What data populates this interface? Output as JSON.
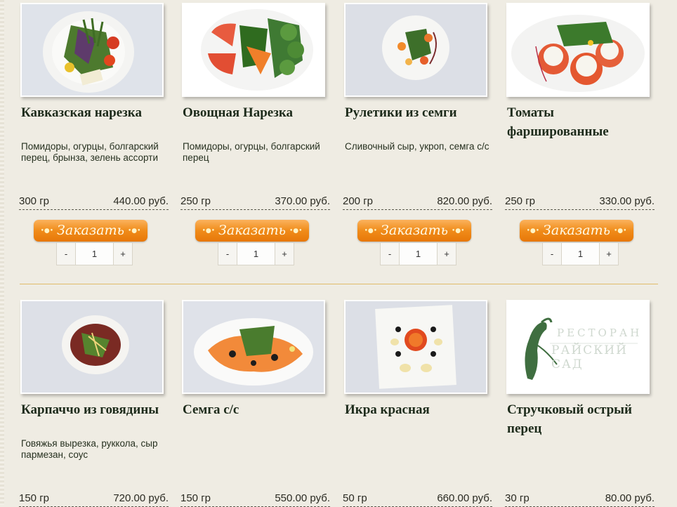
{
  "row1": [
    {
      "title": "Кавказская нарезка",
      "desc": "Помидоры, огурцы, болгарский перец, брынза, зелень ассорти",
      "weight": "300 гр",
      "price": "440.00 руб.",
      "order": "Заказать",
      "qty": "1"
    },
    {
      "title": "Овощная Нарезка",
      "desc": "Помидоры, огурцы, болгарский перец",
      "weight": "250 гр",
      "price": "370.00 руб.",
      "order": "Заказать",
      "qty": "1"
    },
    {
      "title": "Рулетики из семги",
      "desc": "Сливочный сыр, укроп, семга с/с",
      "weight": "200 гр",
      "price": "820.00 руб.",
      "order": "Заказать",
      "qty": "1"
    },
    {
      "title": "Томаты фаршированные",
      "desc": "",
      "weight": "250 гр",
      "price": "330.00 руб.",
      "order": "Заказать",
      "qty": "1"
    }
  ],
  "row2": [
    {
      "title": "Карпаччо из говядины",
      "desc": "Говяжья вырезка, руккола, сыр пармезан, соус",
      "weight": "150 гр",
      "price": "720.00 руб."
    },
    {
      "title": "Семга с/с",
      "desc": "",
      "weight": "150 гр",
      "price": "550.00 руб."
    },
    {
      "title": "Икра красная",
      "desc": "",
      "weight": "50 гр",
      "price": "660.00 руб."
    },
    {
      "title": "Стручковый острый перец",
      "desc": "",
      "weight": "30 гр",
      "price": "80.00 руб."
    }
  ],
  "placeholder_logo": {
    "line1": "РЕСТОРАН",
    "line2": "РАЙСКИЙ САД"
  },
  "controls": {
    "minus": "-",
    "plus": "+"
  },
  "colors": {
    "background": "#efece3",
    "button": "#f08c1a",
    "divider": "#e0bb6a",
    "title": "#1d2b1b"
  }
}
